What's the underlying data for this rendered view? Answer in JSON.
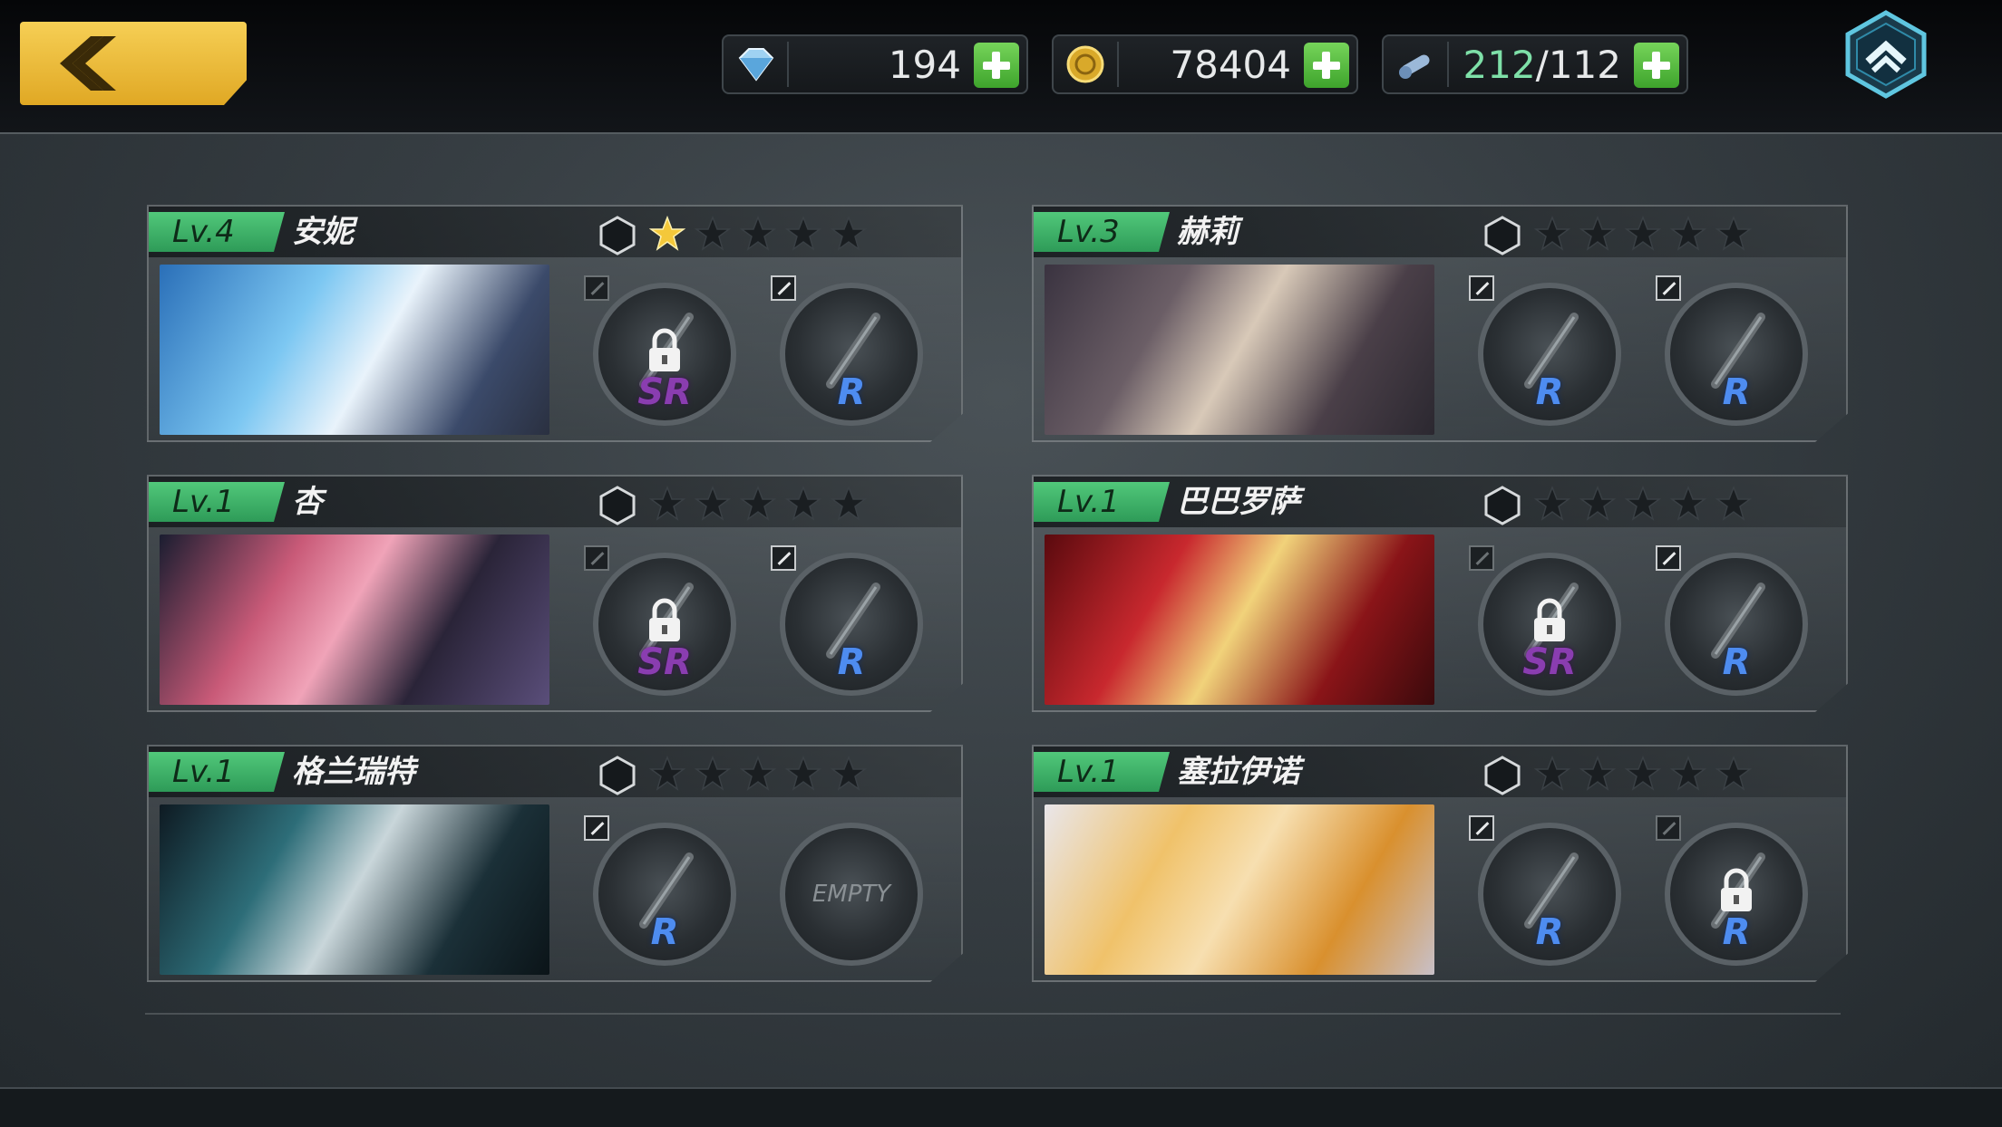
{
  "topbar": {
    "resources": [
      {
        "name": "diamond",
        "icon": "diamond-icon",
        "value": "194",
        "extra": ""
      },
      {
        "name": "gold",
        "icon": "gold-coin-icon",
        "value": "78404",
        "extra": ""
      },
      {
        "name": "stamina",
        "icon": "stamina-icon",
        "value": "212",
        "extra": "/112"
      }
    ]
  },
  "colors": {
    "accent_green": "#3ea42c",
    "back_yellow": "#f0bd3a",
    "level_green": "#46b86c",
    "sr_purple": "#8a3db0",
    "r_blue": "#4e8cf0"
  },
  "characters": [
    {
      "level": "Lv.4",
      "name": "安妮",
      "stars": 1,
      "slots": [
        {
          "rarity": "SR",
          "locked": true,
          "empty": false
        },
        {
          "rarity": "R",
          "locked": false,
          "empty": false
        }
      ]
    },
    {
      "level": "Lv.3",
      "name": "赫莉",
      "stars": 0,
      "slots": [
        {
          "rarity": "R",
          "locked": false,
          "empty": false
        },
        {
          "rarity": "R",
          "locked": false,
          "empty": false
        }
      ]
    },
    {
      "level": "Lv.1",
      "name": "杏",
      "stars": 0,
      "slots": [
        {
          "rarity": "SR",
          "locked": true,
          "empty": false
        },
        {
          "rarity": "R",
          "locked": false,
          "empty": false
        }
      ]
    },
    {
      "level": "Lv.1",
      "name": "巴巴罗萨",
      "stars": 0,
      "slots": [
        {
          "rarity": "SR",
          "locked": true,
          "empty": false
        },
        {
          "rarity": "R",
          "locked": false,
          "empty": false
        }
      ]
    },
    {
      "level": "Lv.1",
      "name": "格兰瑞特",
      "stars": 0,
      "slots": [
        {
          "rarity": "R",
          "locked": false,
          "empty": false
        },
        {
          "rarity": "",
          "locked": false,
          "empty": true,
          "label": "EMPTY"
        }
      ]
    },
    {
      "level": "Lv.1",
      "name": "塞拉伊诺",
      "stars": 0,
      "slots": [
        {
          "rarity": "R",
          "locked": false,
          "empty": false
        },
        {
          "rarity": "R",
          "locked": true,
          "empty": false
        }
      ]
    }
  ],
  "star_max": 5
}
